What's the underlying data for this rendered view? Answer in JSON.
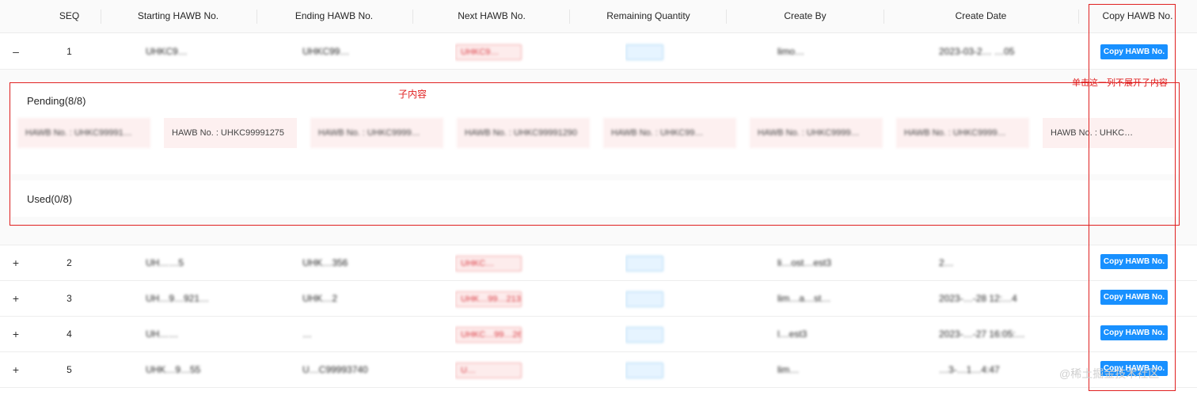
{
  "table": {
    "columns": [
      "SEQ",
      "Starting HAWB No.",
      "Ending HAWB No.",
      "Next HAWB No.",
      "Remaining Quantity",
      "Create By",
      "Create Date",
      "Copy HAWB No."
    ],
    "rows": [
      {
        "expand": "–",
        "seq": "1",
        "start": "UHKC9…",
        "end": "UHKC99…",
        "next": "UHKC9…",
        "remaining": "",
        "create_by": "limo…",
        "create_date": "2023-03-2… …05",
        "copy_label": "Copy HAWB No."
      },
      {
        "expand": "+",
        "seq": "2",
        "start": "UH……5",
        "end": "UHK…356",
        "next": "UHKC…",
        "remaining": "",
        "create_by": "li…ost…est3",
        "create_date": "2…",
        "copy_label": "Copy HAWB No."
      },
      {
        "expand": "+",
        "seq": "3",
        "start": "UH…9…921…",
        "end": "UHK…2",
        "next": "UHK…99…213",
        "remaining": "",
        "create_by": "lim…a…st…",
        "create_date": "2023-…-28 12:…4",
        "copy_label": "Copy HAWB No."
      },
      {
        "expand": "+",
        "seq": "4",
        "start": "UH……",
        "end": "…",
        "next": "UHKC…99…26",
        "remaining": "",
        "create_by": "l…est3",
        "create_date": "2023-…-27 16:05:…",
        "copy_label": "Copy HAWB No."
      },
      {
        "expand": "+",
        "seq": "5",
        "start": "UHK…9…55",
        "end": "U…C99993740",
        "next": "U…",
        "remaining": "",
        "create_by": "lim…",
        "create_date": "…3-…1…4:47",
        "copy_label": "Copy HAWB No."
      }
    ]
  },
  "expanded": {
    "pending_title": "Pending(8/8)",
    "used_title": "Used(0/8)",
    "pending_items": [
      "HAWB No. : UHKC99991…",
      "HAWB No. : UHKC99991275",
      "HAWB No. : UHKC9999…",
      "HAWB No. : UHKC99991290",
      "HAWB No. : UHKC99…",
      "HAWB No. : UHKC9999…",
      "HAWB No. : UHKC9999…",
      "HAWB No. : UHKC…"
    ]
  },
  "annotations": {
    "child_content": "子内容",
    "no_expand_column": "单击这一列不展开子内容"
  },
  "watermark": "@稀土掘金技术社区",
  "colors": {
    "primary": "#1890ff",
    "annotation": "#e02020",
    "tag_red_bg": "#fdecec",
    "tag_blue_bg": "#e6f4ff"
  }
}
